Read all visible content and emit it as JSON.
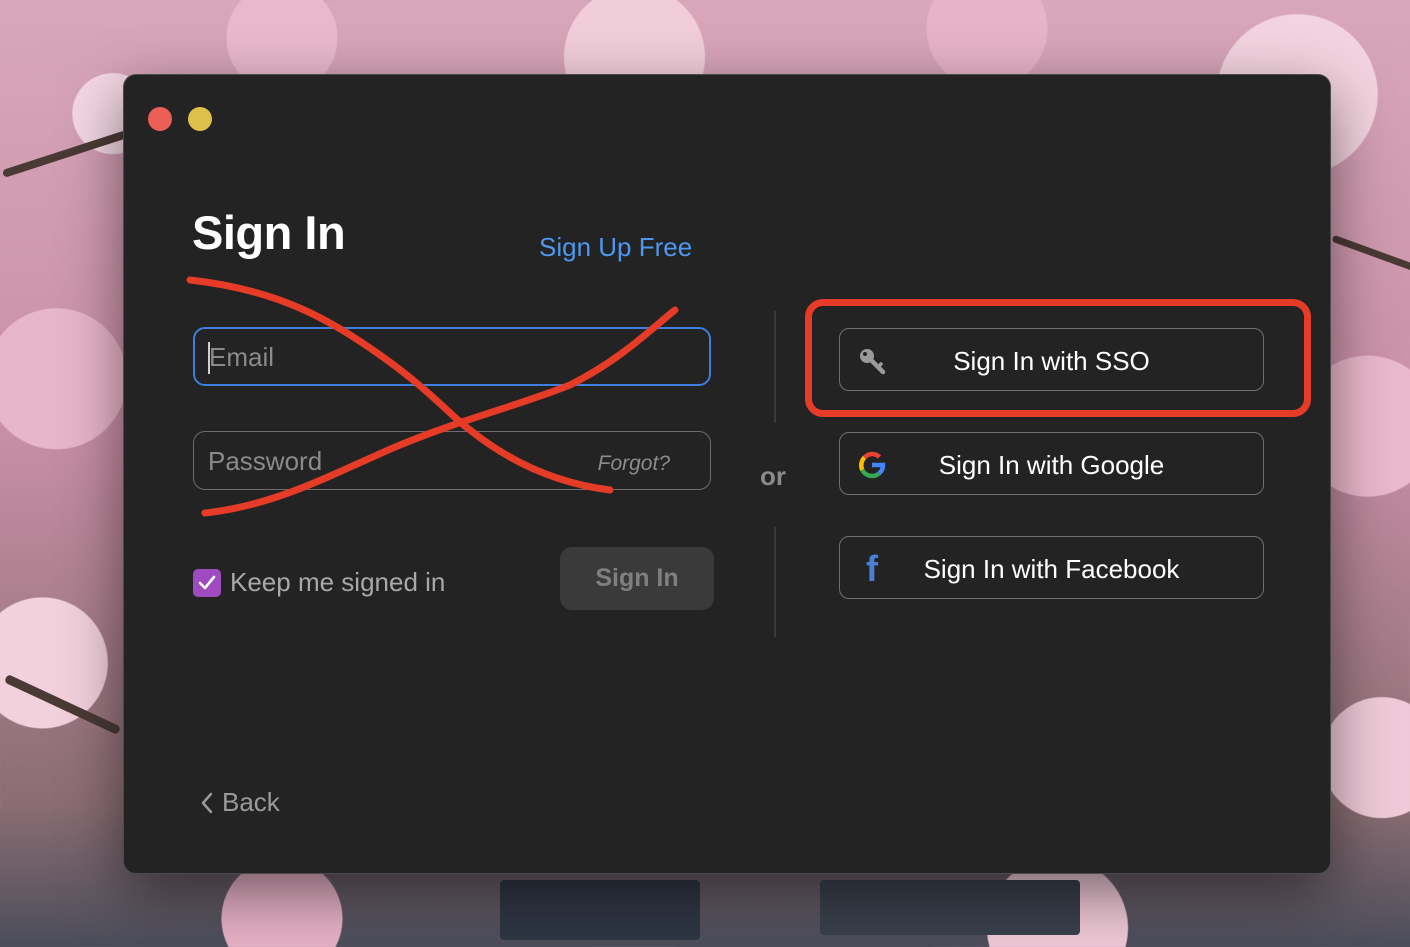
{
  "window": {
    "title": "Sign In",
    "signup_link": "Sign Up Free"
  },
  "form": {
    "email_placeholder": "Email",
    "password_placeholder": "Password",
    "forgot_label": "Forgot?",
    "keep_signed_in_label": "Keep me signed in",
    "keep_signed_in_checked": true,
    "signin_button": "Sign In"
  },
  "divider_label": "or",
  "providers": [
    {
      "label": "Sign In with SSO",
      "icon": "key-icon"
    },
    {
      "label": "Sign In with Google",
      "icon": "google-logo-icon"
    },
    {
      "label": "Sign In with Facebook",
      "icon": "facebook-logo-icon"
    }
  ],
  "back_label": "Back",
  "colors": {
    "accent_link": "#4d97f0",
    "checkbox": "#9e4bc2",
    "annotation_red": "#e63b26"
  }
}
